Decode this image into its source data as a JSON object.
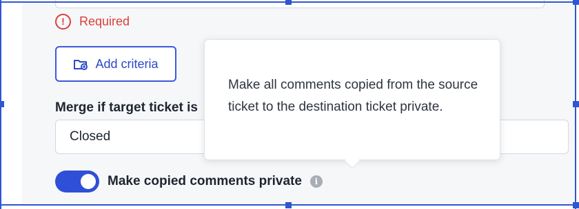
{
  "form": {
    "error_message": "Required",
    "add_criteria_label": "Add criteria",
    "merge_label": "Merge if target ticket is",
    "merge_value": "Closed",
    "private_toggle": {
      "label": "Make copied comments private",
      "enabled": true
    }
  },
  "tooltip": {
    "text": "Make all comments copied from the source ticket to the destination ticket private."
  },
  "icons": {
    "error": "exclamation-circle-icon",
    "add_criteria": "add-filter-icon",
    "info": "info-icon"
  },
  "colors": {
    "accent": "#2f4fd6",
    "error": "#d93f3c",
    "selection": "#2f56cf"
  }
}
